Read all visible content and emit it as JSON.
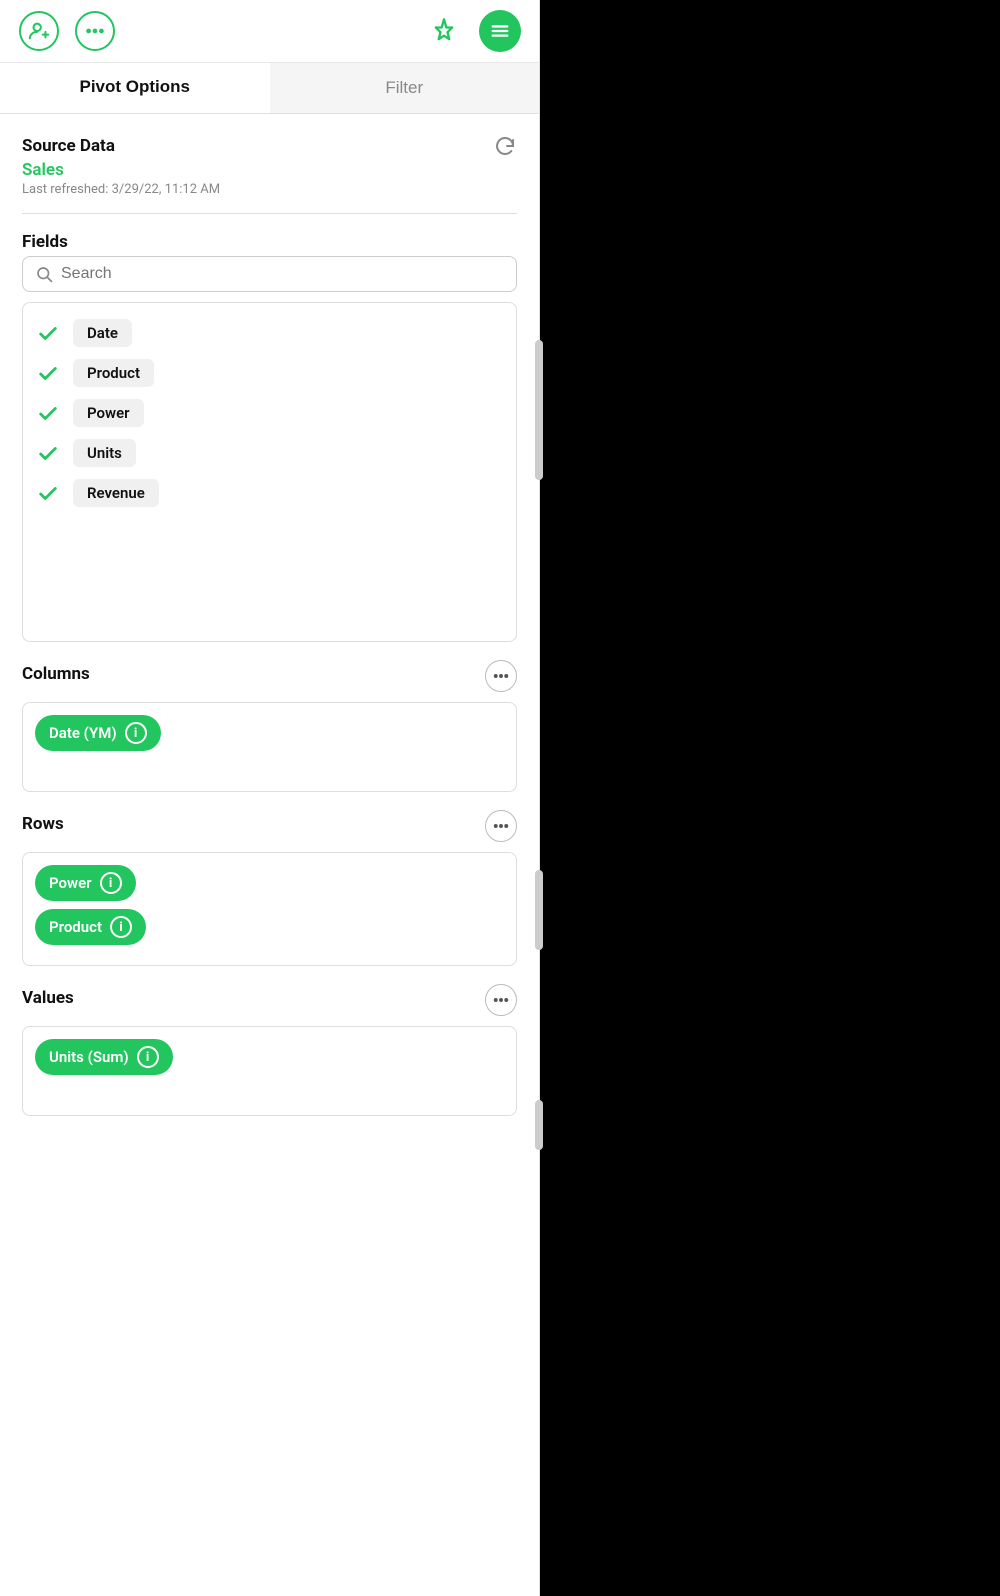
{
  "header": {
    "add_user_label": "add-user",
    "more_label": "more",
    "pin_label": "pin",
    "menu_label": "menu"
  },
  "tabs": [
    {
      "label": "Pivot Options",
      "active": true
    },
    {
      "label": "Filter",
      "active": false
    }
  ],
  "source_data": {
    "label": "Source Data",
    "name": "Sales",
    "last_refreshed": "Last refreshed: 3/29/22, 11:12 AM"
  },
  "fields": {
    "label": "Fields",
    "search_placeholder": "Search",
    "items": [
      {
        "label": "Date",
        "checked": true
      },
      {
        "label": "Product",
        "checked": true
      },
      {
        "label": "Power",
        "checked": true
      },
      {
        "label": "Units",
        "checked": true
      },
      {
        "label": "Revenue",
        "checked": true
      }
    ]
  },
  "columns": {
    "label": "Columns",
    "items": [
      {
        "label": "Date (YM)"
      }
    ]
  },
  "rows": {
    "label": "Rows",
    "items": [
      {
        "label": "Power"
      },
      {
        "label": "Product"
      }
    ]
  },
  "values": {
    "label": "Values",
    "items": [
      {
        "label": "Units (Sum)"
      }
    ]
  },
  "colors": {
    "green": "#22c55e",
    "light_green_bg": "#e8f7ee",
    "tag_bg": "#f0f0f0"
  }
}
